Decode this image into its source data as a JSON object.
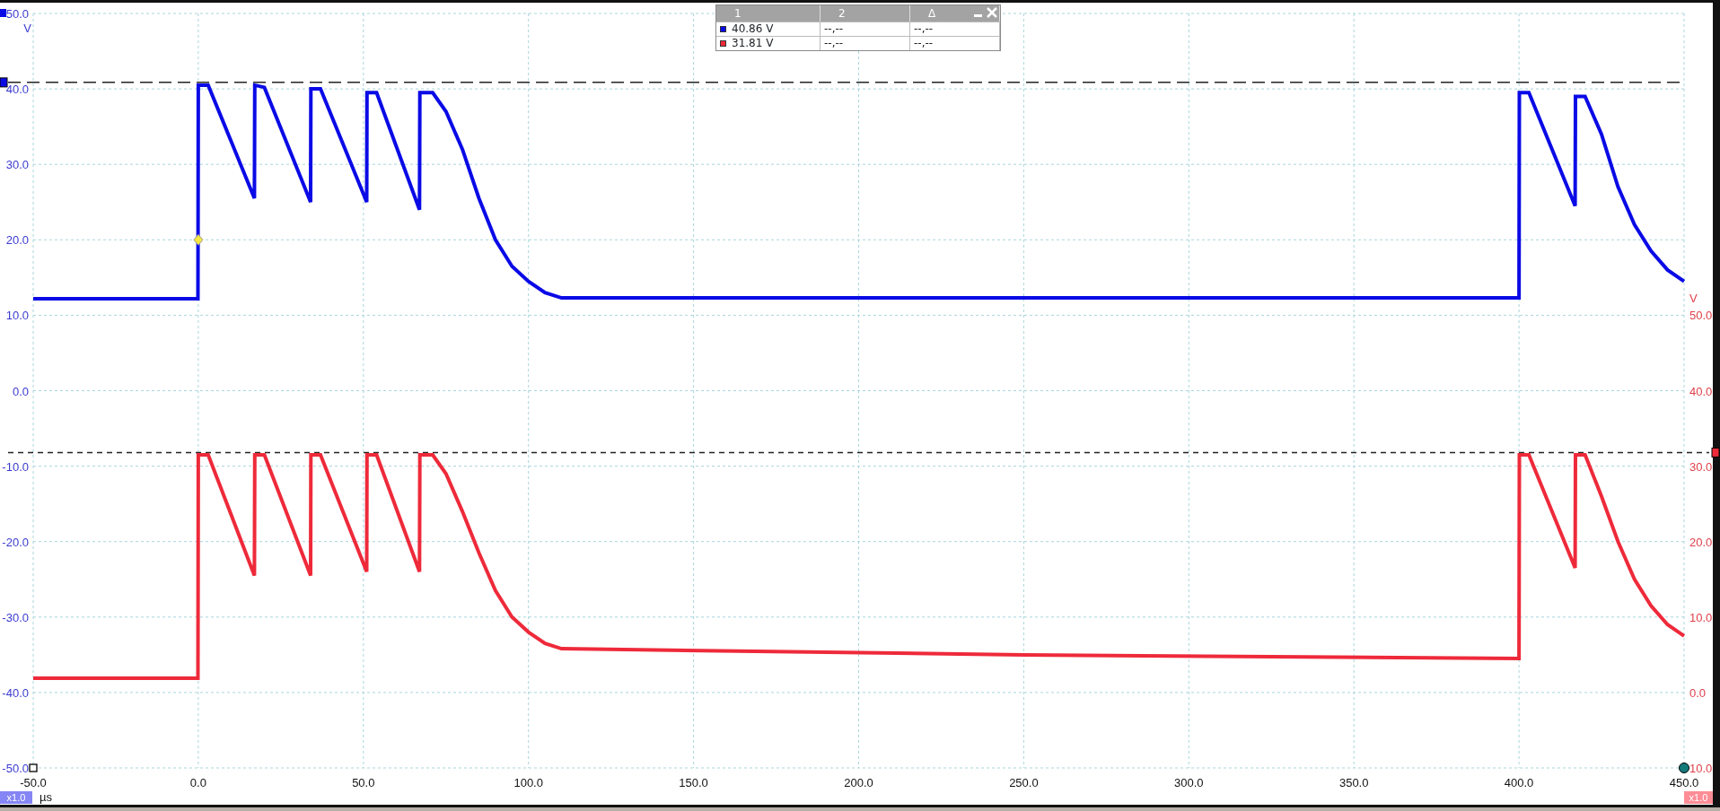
{
  "scope": {
    "chart_data": {
      "type": "line",
      "xlabel": "µs",
      "ylabel": "V",
      "xlim": [
        -50,
        450
      ],
      "ylim": [
        -50,
        50
      ],
      "y2lim": [
        -10,
        90
      ],
      "xticks": [
        {
          "value": -50,
          "label": "-50.0"
        },
        {
          "value": 0,
          "label": "0.0"
        },
        {
          "value": 50,
          "label": "50.0"
        },
        {
          "value": 100,
          "label": "100.0"
        },
        {
          "value": 150,
          "label": "150.0"
        },
        {
          "value": 200,
          "label": "200.0"
        },
        {
          "value": 250,
          "label": "250.0"
        },
        {
          "value": 300,
          "label": "300.0"
        },
        {
          "value": 350,
          "label": "350.0"
        },
        {
          "value": 400,
          "label": "400.0"
        },
        {
          "value": 450,
          "label": "450.0"
        }
      ],
      "yticks": [
        {
          "value": 50,
          "label": "50.0"
        },
        {
          "value": 40,
          "label": "40.0"
        },
        {
          "value": 30,
          "label": "30.0"
        },
        {
          "value": 20,
          "label": "20.0"
        },
        {
          "value": 10,
          "label": "10.0"
        },
        {
          "value": 0,
          "label": "0.0"
        },
        {
          "value": -10,
          "label": "-10.0"
        },
        {
          "value": -20,
          "label": "-20.0"
        },
        {
          "value": -30,
          "label": "-30.0"
        },
        {
          "value": -40,
          "label": "-40.0"
        },
        {
          "value": -50,
          "label": "-50.0"
        }
      ],
      "y2label": "V",
      "y2ticks": [
        {
          "value": 50,
          "label": "50.0"
        },
        {
          "value": 40,
          "label": "40.0"
        },
        {
          "value": 30,
          "label": "30.0"
        },
        {
          "value": 20,
          "label": "20.0"
        },
        {
          "value": 10,
          "label": "10.0"
        },
        {
          "value": 0,
          "label": "0.0"
        },
        {
          "value": -10,
          "label": "10.0"
        }
      ],
      "x": [
        -50,
        -0.1,
        0,
        3,
        17,
        17.1,
        20,
        34,
        34.1,
        37,
        51,
        51.1,
        54,
        67,
        67.1,
        71,
        75,
        80,
        85,
        90,
        95,
        100,
        105,
        110,
        250,
        400,
        400.1,
        403,
        417,
        417.1,
        420,
        425,
        430,
        435,
        440,
        445,
        450
      ],
      "series": [
        {
          "color": "#0a0ae6",
          "values": [
            12.2,
            12.2,
            40.5,
            40.5,
            25.5,
            40.5,
            40.2,
            25,
            40,
            40,
            25,
            39.5,
            39.5,
            24,
            39.5,
            39.5,
            37,
            32,
            25.5,
            20,
            16.5,
            14.5,
            13,
            12.3,
            12.3,
            12.3,
            39.5,
            39.5,
            24.5,
            39,
            39,
            34,
            27,
            22,
            18.5,
            16,
            14.5
          ]
        },
        {
          "color": "#ee2a3a",
          "axis": "y2",
          "values": [
            1.9,
            1.9,
            31.5,
            31.5,
            15.5,
            31.5,
            31.5,
            15.5,
            31.5,
            31.5,
            16,
            31.5,
            31.5,
            16,
            31.5,
            31.5,
            29,
            24,
            18.5,
            13.5,
            10,
            8,
            6.5,
            5.8,
            5,
            4.5,
            31.5,
            31.5,
            16.5,
            31.5,
            31.5,
            26,
            20,
            15,
            11.5,
            9,
            7.5
          ]
        }
      ],
      "grid": true,
      "ref_lines": [
        {
          "value": 40.86,
          "axis": "y"
        },
        {
          "value": 31.81,
          "axis": "y2"
        }
      ]
    },
    "left_scale": "x1.0",
    "right_scale": "x1.0"
  },
  "measurements": {
    "columns": [
      "1",
      "2",
      "Δ"
    ],
    "rows": [
      {
        "color": "#0a0ae6",
        "cells": [
          "40.86 V",
          "--,--",
          "--,--"
        ]
      },
      {
        "color": "#ee2a3a",
        "cells": [
          "31.81 V",
          "--,--",
          "--,--"
        ]
      }
    ]
  }
}
